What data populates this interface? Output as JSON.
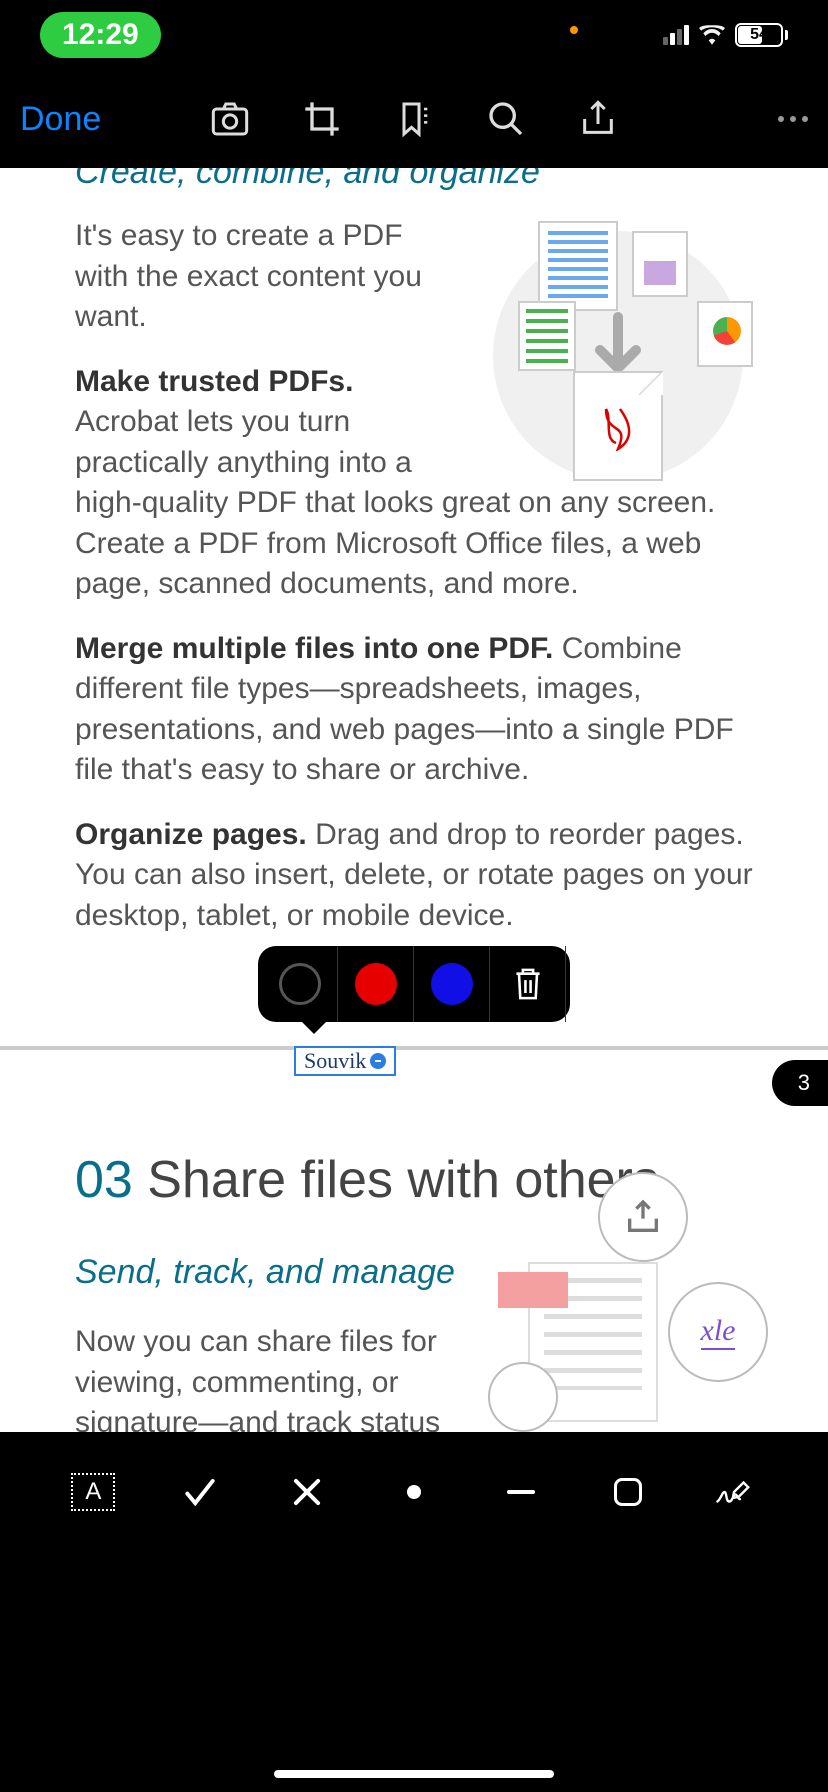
{
  "status": {
    "time": "12:29",
    "battery": "54"
  },
  "toolbar": {
    "done": "Done"
  },
  "doc": {
    "header1": "Create, combine, and organize",
    "intro": "It's easy to create a PDF with the exact content you want.",
    "p1_bold": "Make trusted PDFs.",
    "p1": " Acrobat lets you turn practically anything into a high-quality PDF that looks great on any screen. Create a PDF from Microsoft Office files, a web page, scanned documents, and more.",
    "p2_bold": "Merge multiple files into one PDF.",
    "p2": " Combine different file types—spreadsheets, images, presentations, and web pages—into a single PDF file that's easy to share or archive.",
    "p3_bold": "Organize pages.",
    "p3": " Drag and drop to reorder pages. You can also insert, delete, or rotate pages on your desktop, tablet, or mobile device.",
    "signature_text": "Souvik",
    "page_number": "3",
    "section2_num": "03",
    "section2_title": " Share files with others",
    "section2_sub": "Send, track, and manage",
    "section2_body": "Now you can share files for viewing, commenting, or signature—and track status every step of the way.",
    "sign_sample": "xle"
  },
  "bottombar": {
    "text_icon_label": "A"
  },
  "colors": {
    "accent": "#0a84ff",
    "teal": "#0a6e8a"
  }
}
